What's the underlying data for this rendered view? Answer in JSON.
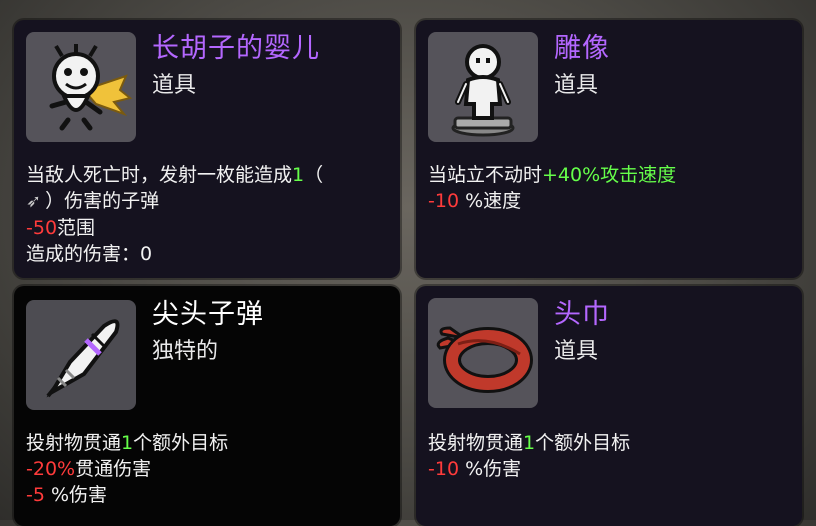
{
  "colors": {
    "title_purple": "#b467ff",
    "title_white": "#ffffff",
    "negative": "#ff3b3b",
    "positive": "#66ff4a",
    "text": "#f2f2f2"
  },
  "cards": [
    {
      "icon": "bearded-baby-icon",
      "title": "长胡子的婴儿",
      "subtitle": "道具",
      "line1": {
        "a": "当敌人死亡时，发射一枚能造成",
        "b": "1",
        "c": "（"
      },
      "line2": {
        "icon": "bullet-arrow-icon",
        "text": "）伤害的子弹"
      },
      "line3": {
        "value": "-50",
        "text": "范围"
      },
      "line4": "造成的伤害：0"
    },
    {
      "icon": "statue-icon",
      "title": "雕像",
      "subtitle": "道具",
      "line1": {
        "a": "当站立不动时",
        "b": "+40%攻击速度"
      },
      "line2": {
        "value": "-10",
        "text": " %速度"
      }
    },
    {
      "icon": "pointed-bullet-icon",
      "title": "尖头子弹",
      "subtitle": "独特的",
      "line1": {
        "a": "投射物贯通",
        "b": "1",
        "c": "个额外目标"
      },
      "line2": {
        "value": "-20%",
        "text": "贯通伤害"
      },
      "line3": {
        "value": "-5",
        "text": " %伤害"
      }
    },
    {
      "icon": "bandana-icon",
      "title": "头巾",
      "subtitle": "道具",
      "line1": {
        "a": "投射物贯通",
        "b": "1",
        "c": "个额外目标"
      },
      "line2": {
        "value": "-10",
        "text": " %伤害"
      }
    }
  ]
}
